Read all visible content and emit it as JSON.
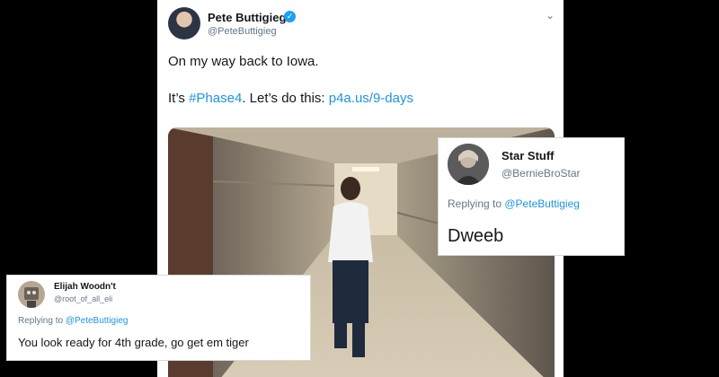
{
  "main_tweet": {
    "name": "Pete Buttigieg",
    "handle": "@PeteButtigieg",
    "verified_mark": "✓",
    "menu_icon": "⌄",
    "line1": "On my way back to Iowa.",
    "line2_prefix": "It’s ",
    "hashtag": "#Phase4",
    "line2_mid": ". Let’s do this: ",
    "link": "p4a.us/9-days",
    "photo_alt": "man walking down a hallway"
  },
  "reply_star": {
    "name": "Star Stuff",
    "handle": "@BernieBroStar",
    "replying_prefix": "Replying to ",
    "replying_to": "@PeteButtigieg",
    "text": "Dweeb"
  },
  "reply_eli": {
    "name": "Elijah Woodn't",
    "handle": "@root_of_all_eli",
    "replying_prefix": "Replying to ",
    "replying_to": "@PeteButtigieg",
    "text": "You look ready for 4th grade, go get em tiger"
  },
  "colors": {
    "background": "#000000",
    "link": "#1b95e0",
    "verified": "#1da1f2",
    "muted": "#657786"
  }
}
